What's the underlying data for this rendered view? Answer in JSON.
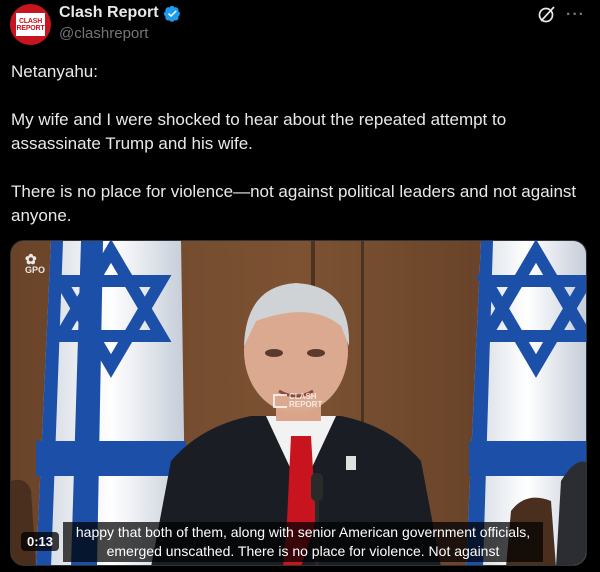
{
  "author": {
    "display_name": "Clash Report",
    "handle": "@clashreport",
    "avatar_text_line1": "CLASH",
    "avatar_text_line2": "REPORT",
    "verified_color": "#1d9bf0"
  },
  "tweet": {
    "line1": "Netanyahu:",
    "line2": "My wife and I were shocked to hear about the repeated attempt to assassinate Trump and his wife.",
    "line3": "There is no place for violence—not against political leaders and not against anyone."
  },
  "media": {
    "logo_text": "GPO",
    "watermark_line1": "CLASH",
    "watermark_line2": "REPORT",
    "subtitle_line1": "happy that both of them, along with senior American government officials,",
    "subtitle_line2": "emerged unscathed.  There is no place for violence.  Not against",
    "timestamp": "0:13"
  },
  "icons": {
    "grok": "grok-icon",
    "more": "more-icon",
    "verified": "verified-badge-icon"
  },
  "colors": {
    "background": "#000000",
    "text": "#e7e9ea",
    "secondary": "#71767b",
    "brand_red": "#c8141e",
    "flag_blue": "#1c4fa8"
  }
}
